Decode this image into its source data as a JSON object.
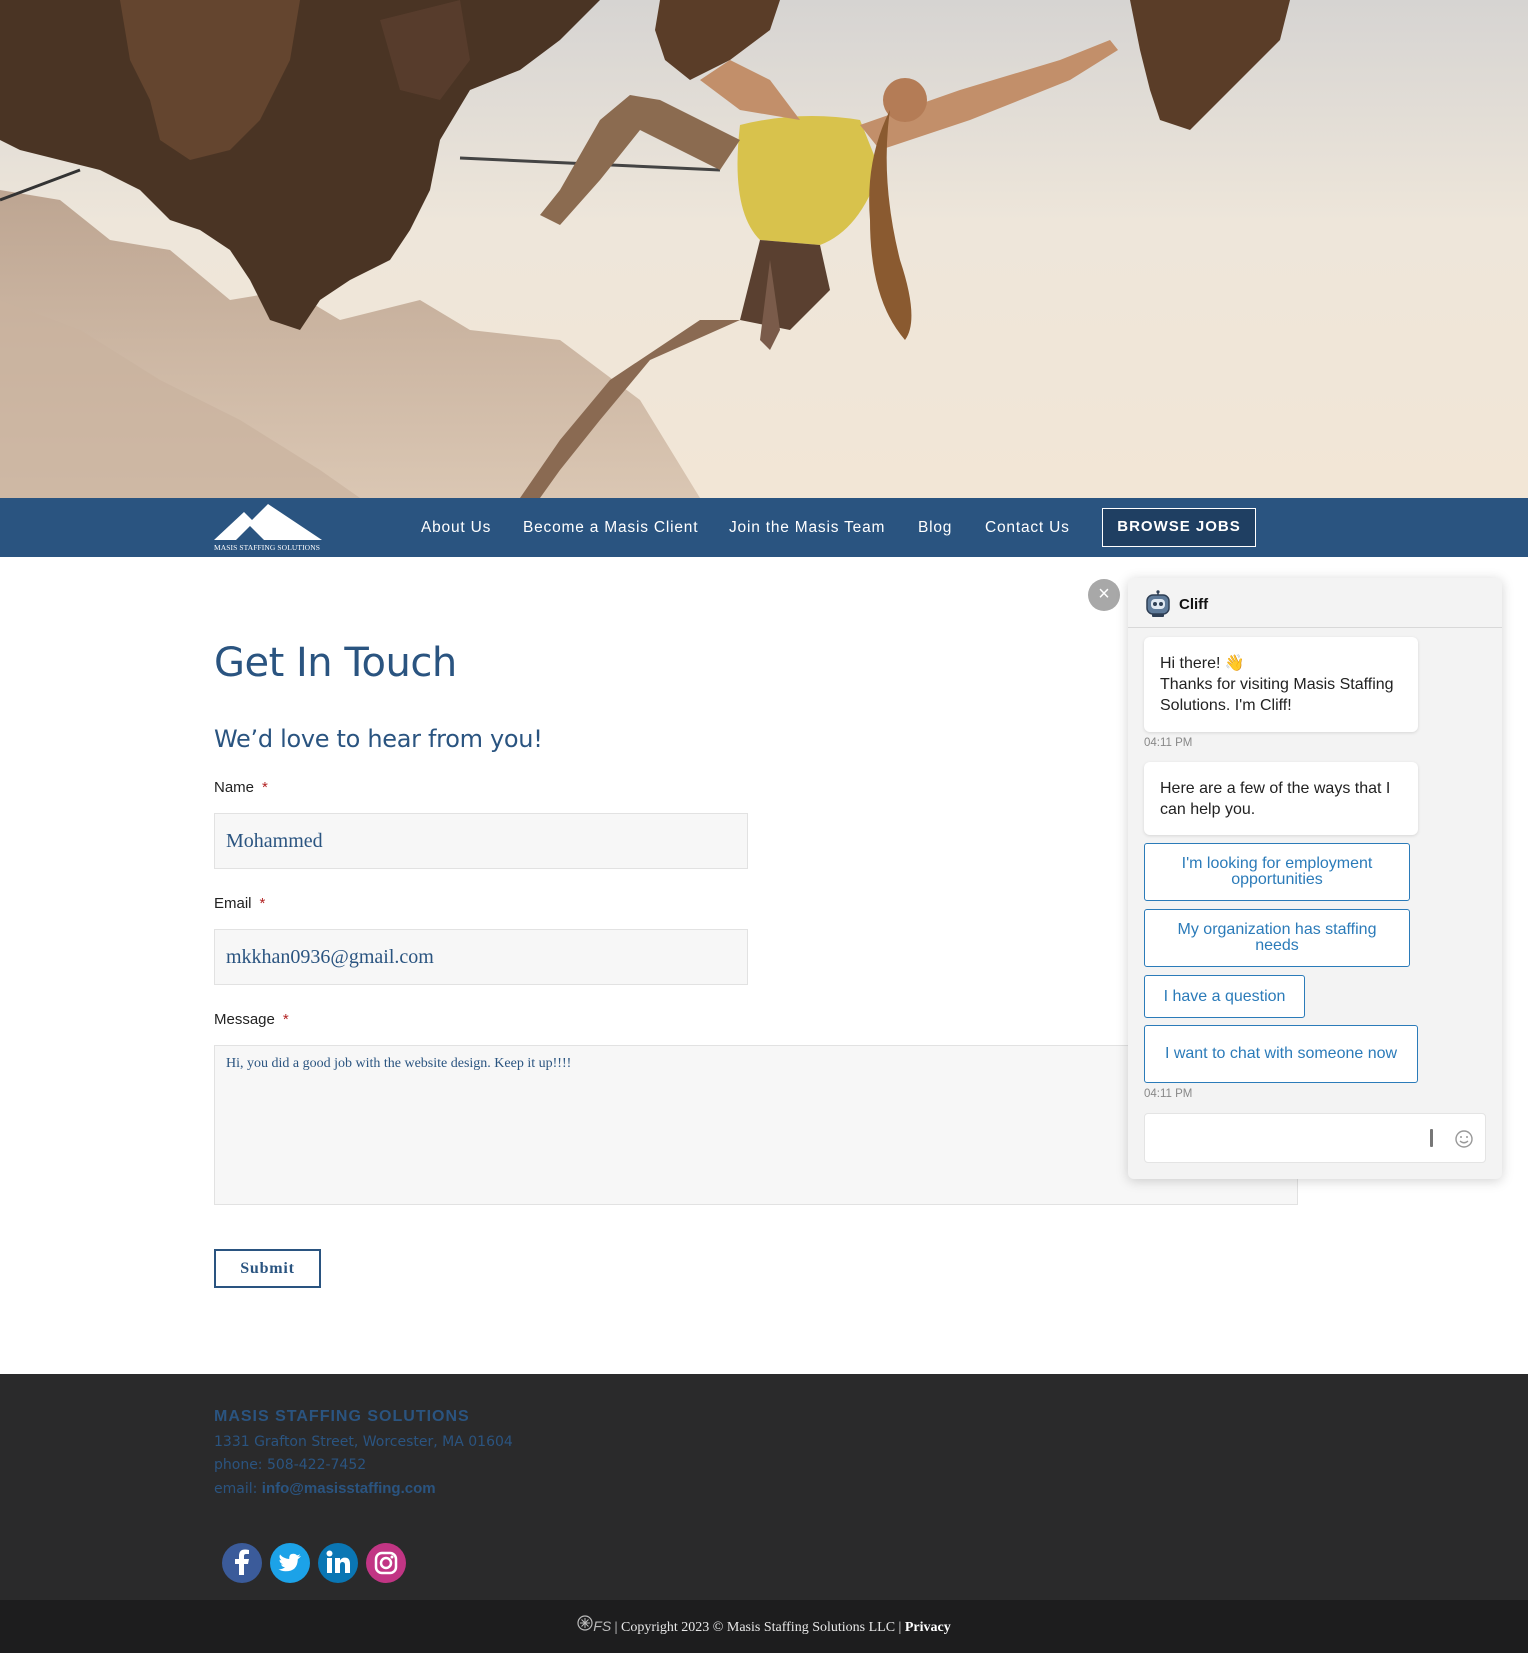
{
  "nav": {
    "logo_text": "MASIS STAFFING SOLUTIONS",
    "links": [
      "About Us",
      "Become a Masis Client",
      "Join the Masis Team",
      "Blog",
      "Contact Us"
    ],
    "cta": "BROWSE JOBS"
  },
  "contact": {
    "title": "Get In Touch",
    "subtitle": "We’d love to hear from you!",
    "required_mark": "*",
    "name_label": "Name",
    "name_value": "Mohammed",
    "email_label": "Email",
    "email_value": "mkkhan0936@gmail.com",
    "message_label": "Message",
    "message_value": "Hi, you did a good job with the website design. Keep it up!!!!",
    "submit_label": "Submit"
  },
  "footer": {
    "company": "MASIS STAFFING SOLUTIONS",
    "address": "1331 Grafton Street, Worcester, MA 01604",
    "phone": "phone: 508-422-7452",
    "email_label": "email:",
    "email_value": "info@masisstaffing.com",
    "socials": [
      "facebook-icon",
      "twitter-icon",
      "linkedin-icon",
      "instagram-icon"
    ],
    "copyright_logo": "FS",
    "copyright": "| Copyright 2023 © Masis Staffing Solutions LLC |",
    "privacy": "Privacy"
  },
  "chat": {
    "close": "×",
    "bot_name": "Cliff",
    "greeting_line1": "Hi there! 👋",
    "greeting_line2": "Thanks for visiting Masis Staffing Solutions. I'm Cliff!",
    "time1": "04:11 PM",
    "help_text": "Here are a few of the ways that I can help you.",
    "options": [
      "I'm looking for employment opportunities",
      "My organization has staffing needs",
      "I have a question",
      "I want to chat with someone now"
    ],
    "time2": "04:11 PM",
    "input_value": ""
  },
  "colors": {
    "brand": "#2a5480",
    "chat_accent": "#2b7bb9",
    "footer_bg": "#2a2a2b",
    "required": "#b22222"
  }
}
